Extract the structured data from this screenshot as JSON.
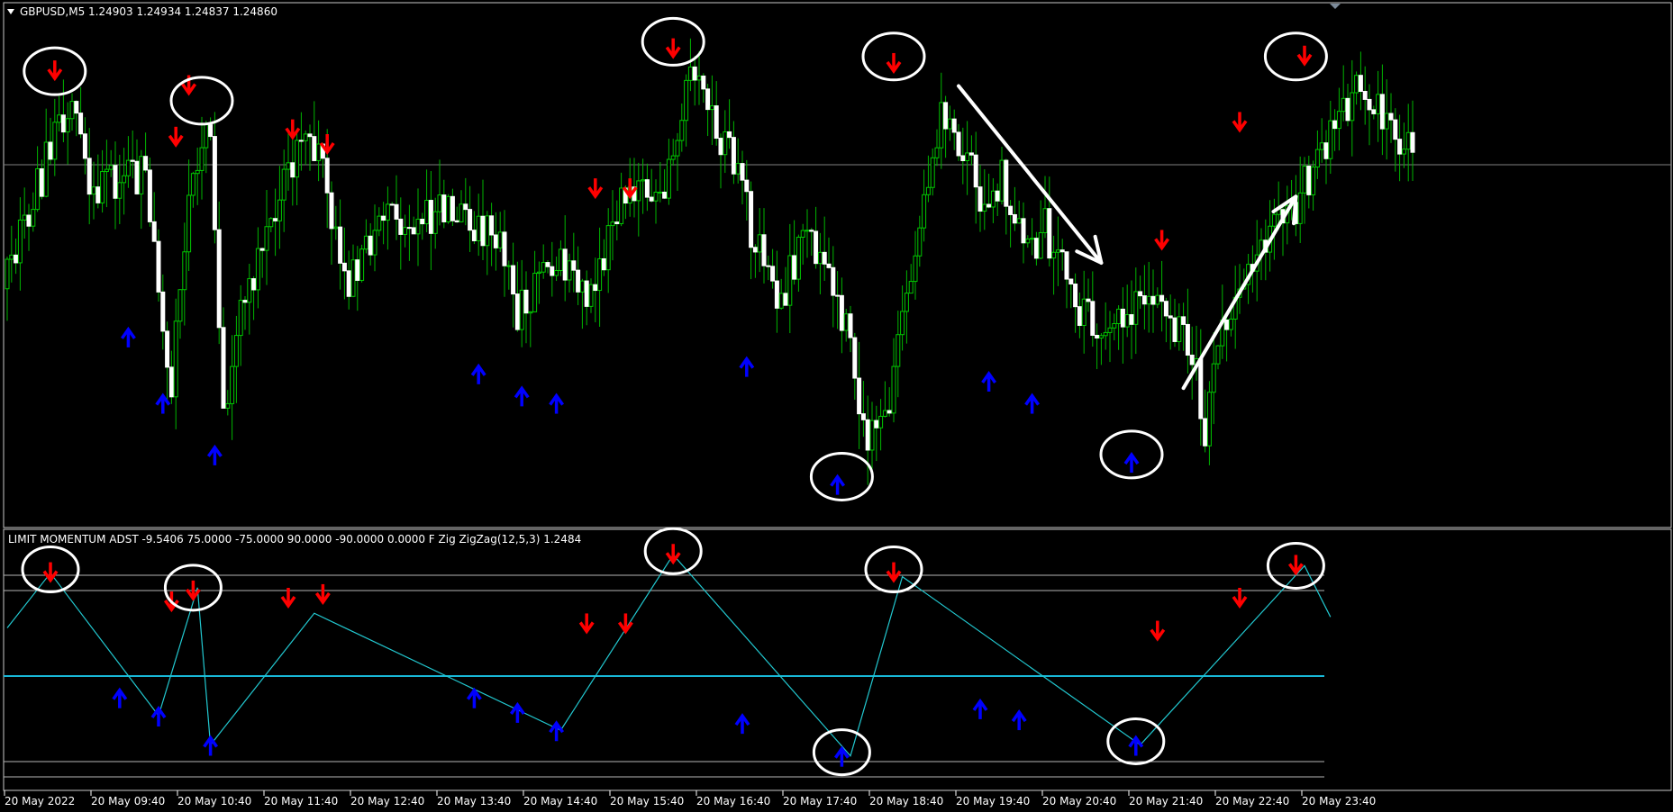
{
  "chart_data": {
    "type": "candlestick",
    "symbol_header": "GBPUSD,M5  1.24903 1.24934 1.24837 1.24860",
    "indicator_header": "LIMIT MOMENTUM ADST -9.5406 75.0000 -75.0000 90.0000 -90.0000 0.0000  F Zig   ZigZag(12,5,3) 1.2484",
    "x_ticks": [
      "20 May 2022",
      "20 May 09:40",
      "20 May 10:40",
      "20 May 11:40",
      "20 May 12:40",
      "20 May 13:40",
      "20 May 14:40",
      "20 May 15:40",
      "20 May 16:40",
      "20 May 17:40",
      "20 May 18:40",
      "20 May 19:40",
      "20 May 20:40",
      "20 May 21:40",
      "20 May 22:40",
      "20 May 23:40"
    ],
    "colors": {
      "background": "#000000",
      "candle_up": "#00c800",
      "candle_down": "#ffffff",
      "wick": "#00b400",
      "sell_arrow": "#ff0000",
      "buy_arrow": "#0000ff",
      "zigzag": "#22c8d0",
      "zero_line": "#18b8d8",
      "level_lines": "#b4b4b4",
      "annotation": "#ffffff"
    },
    "price_path": [
      [
        0,
        1.2468
      ],
      [
        15,
        1.2492
      ],
      [
        20,
        1.2478
      ],
      [
        32,
        1.2482
      ],
      [
        38,
        1.2452
      ],
      [
        42,
        1.248
      ],
      [
        47,
        1.2488
      ],
      [
        50,
        1.2449
      ],
      [
        55,
        1.2464
      ],
      [
        60,
        1.2474
      ],
      [
        68,
        1.2484
      ],
      [
        73,
        1.2483
      ],
      [
        78,
        1.2466
      ],
      [
        88,
        1.2475
      ],
      [
        100,
        1.2476
      ],
      [
        113,
        1.2473
      ],
      [
        118,
        1.2462
      ],
      [
        128,
        1.247
      ],
      [
        134,
        1.2465
      ],
      [
        142,
        1.2477
      ],
      [
        152,
        1.2478
      ],
      [
        158,
        1.2497
      ],
      [
        168,
        1.2482
      ],
      [
        178,
        1.2462
      ],
      [
        185,
        1.2474
      ],
      [
        195,
        1.2458
      ],
      [
        198,
        1.2445
      ],
      [
        204,
        1.2449
      ],
      [
        207,
        1.246
      ],
      [
        216,
        1.2488
      ],
      [
        226,
        1.2478
      ],
      [
        230,
        1.248
      ],
      [
        236,
        1.247
      ],
      [
        240,
        1.2474
      ],
      [
        248,
        1.2463
      ],
      [
        256,
        1.246
      ],
      [
        264,
        1.2467
      ],
      [
        275,
        1.2455
      ],
      [
        277,
        1.2445
      ],
      [
        281,
        1.2461
      ],
      [
        290,
        1.2473
      ],
      [
        297,
        1.2476
      ],
      [
        306,
        1.2486
      ],
      [
        313,
        1.2493
      ],
      [
        325,
        1.2484
      ]
    ],
    "down_count": 180,
    "up_count": 146,
    "indicator_zigzag": [
      [
        0,
        1.2477
      ],
      [
        10,
        1.2492
      ],
      [
        35,
        1.2453
      ],
      [
        44,
        1.2488
      ],
      [
        47,
        1.2445
      ],
      [
        71,
        1.2481
      ],
      [
        128,
        1.2449
      ],
      [
        154,
        1.2497
      ],
      [
        195,
        1.2442
      ],
      [
        207,
        1.2491
      ],
      [
        262,
        1.2445
      ],
      [
        300,
        1.2494
      ],
      [
        306,
        1.248
      ]
    ],
    "upper_pane_arrows": {
      "sell": [
        [
          11,
          1.2495
        ],
        [
          39,
          1.2486
        ],
        [
          42,
          1.2493
        ],
        [
          66,
          1.2487
        ],
        [
          74,
          1.2485
        ],
        [
          136,
          1.2479
        ],
        [
          144,
          1.2479
        ],
        [
          154,
          1.2498
        ],
        [
          205,
          1.2496
        ],
        [
          267,
          1.2472
        ],
        [
          285,
          1.2488
        ],
        [
          300,
          1.2497
        ]
      ],
      "buy": [
        [
          28,
          1.2459
        ],
        [
          36,
          1.245
        ],
        [
          48,
          1.2443
        ],
        [
          109,
          1.2454
        ],
        [
          119,
          1.2451
        ],
        [
          127,
          1.245
        ],
        [
          171,
          1.2455
        ],
        [
          192,
          1.2439
        ],
        [
          227,
          1.2453
        ],
        [
          237,
          1.245
        ],
        [
          260,
          1.2442
        ]
      ]
    },
    "indicator_arrows": {
      "sell": [
        [
          10,
          1.2492
        ],
        [
          38,
          1.2484
        ],
        [
          43,
          1.2487
        ],
        [
          65,
          1.2485
        ],
        [
          73,
          1.2486
        ],
        [
          134,
          1.2478
        ],
        [
          143,
          1.2478
        ],
        [
          154,
          1.2497
        ],
        [
          205,
          1.2492
        ],
        [
          266,
          1.2476
        ],
        [
          285,
          1.2485
        ],
        [
          298,
          1.2494
        ]
      ],
      "buy": [
        [
          26,
          1.2458
        ],
        [
          35,
          1.2453
        ],
        [
          47,
          1.2445
        ],
        [
          108,
          1.2458
        ],
        [
          118,
          1.2454
        ],
        [
          127,
          1.2449
        ],
        [
          170,
          1.2451
        ],
        [
          193,
          1.2442
        ],
        [
          225,
          1.2455
        ],
        [
          234,
          1.2452
        ],
        [
          261,
          1.2445
        ]
      ]
    },
    "circles_upper": [
      [
        11,
        1.2495
      ],
      [
        45,
        1.2491
      ],
      [
        154,
        1.2499
      ],
      [
        205,
        1.2497
      ],
      [
        298,
        1.2497
      ],
      [
        193,
        1.244
      ],
      [
        260,
        1.2443
      ]
    ],
    "circles_lower": [
      [
        10,
        1.2493
      ],
      [
        43,
        1.2488
      ],
      [
        154,
        1.2498
      ],
      [
        205,
        1.2493
      ],
      [
        298,
        1.2494
      ],
      [
        193,
        1.2443
      ],
      [
        261,
        1.2446
      ]
    ],
    "annotation_arrows": [
      {
        "from": [
          220,
          1.2493
        ],
        "to": [
          253,
          1.2469
        ]
      },
      {
        "from": [
          272,
          1.2452
        ],
        "to": [
          298,
          1.2478
        ]
      }
    ]
  }
}
